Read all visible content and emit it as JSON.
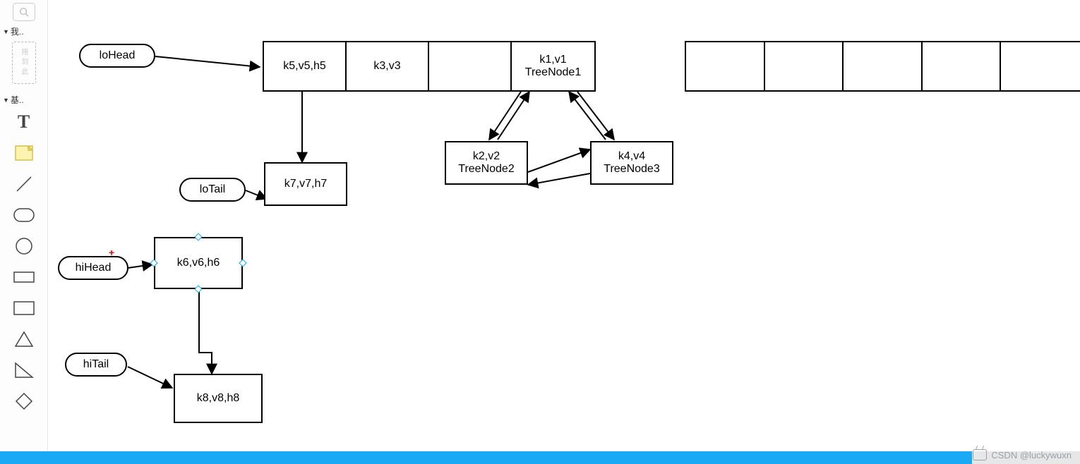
{
  "sidebar": {
    "section_my": "我..",
    "drop_hint": "拖到此",
    "section_basic": "基..",
    "tools": {
      "text_glyph": "T",
      "note": "note",
      "line": "line",
      "rounded_rect": "rounded-rect",
      "circle": "circle",
      "rect_thin": "rect",
      "rect_thick": "rect",
      "triangle": "triangle",
      "right_triangle": "right-triangle",
      "diamond": "diamond"
    }
  },
  "diagram": {
    "pointers": {
      "loHead": "loHead",
      "loTail": "loTail",
      "hiHead": "hiHead",
      "hiTail": "hiTail"
    },
    "array1": {
      "cells": [
        {
          "line1": "k5,v5,h5",
          "line2": ""
        },
        {
          "line1": "k3,v3",
          "line2": ""
        },
        {
          "line1": "",
          "line2": ""
        },
        {
          "line1": "k1,v1",
          "line2": "TreeNode1"
        }
      ]
    },
    "array2": {
      "cell_count": 5
    },
    "nodes": {
      "k7": "k7,v7,h7",
      "k2_l1": "k2,v2",
      "k2_l2": "TreeNode2",
      "k4_l1": "k4,v4",
      "k4_l2": "TreeNode3",
      "k6": "k6,v6,h6",
      "k8": "k8,v8,h8"
    }
  },
  "footer": {
    "progress_pct": 90,
    "watermark": "CSDN @luckywuxn"
  }
}
